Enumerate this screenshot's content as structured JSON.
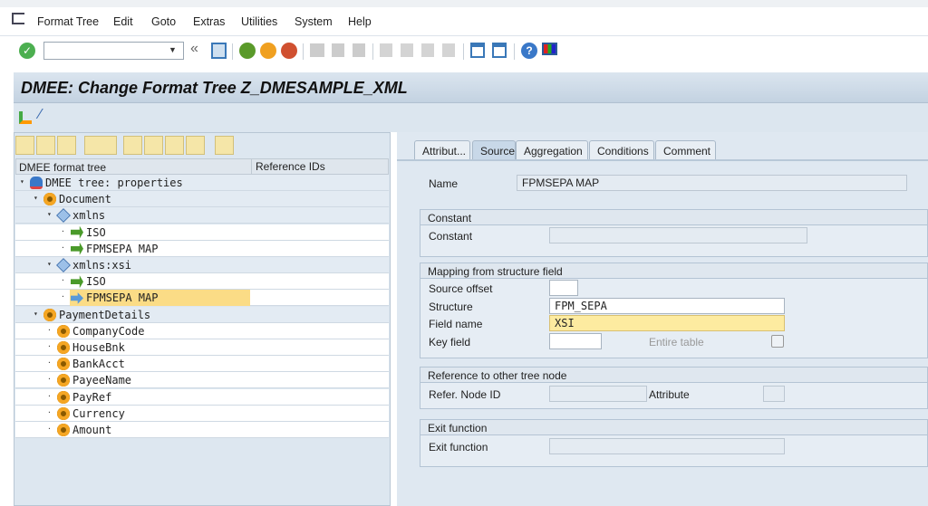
{
  "menubar": {
    "items": [
      "Format Tree",
      "Edit",
      "Goto",
      "Extras",
      "Utilities",
      "System",
      "Help"
    ]
  },
  "toolbar": {
    "command_field": "",
    "icons": [
      "enter-icon",
      "back-icon",
      "exit-icon",
      "cancel-icon",
      "save-icon",
      "print-icon",
      "find-icon",
      "find-next-icon",
      "first-page-icon",
      "prev-page-icon",
      "next-page-icon",
      "last-page-icon",
      "new-session-icon",
      "shortcut-icon",
      "help-icon",
      "customize-icon"
    ]
  },
  "title": "DMEE: Change Format Tree Z_DMESAMPLE_XML",
  "tree": {
    "columns": [
      "DMEE format tree",
      "Reference IDs"
    ],
    "rows": [
      {
        "label": "DMEE tree: properties",
        "level": 0,
        "icon": "tree-properties",
        "expanded": true
      },
      {
        "label": "Document",
        "level": 1,
        "icon": "node",
        "expanded": true
      },
      {
        "label": "xmlns",
        "level": 2,
        "icon": "attribute-tag",
        "expanded": true
      },
      {
        "label": "ISO",
        "level": 3,
        "icon": "mapping",
        "expanded": false
      },
      {
        "label": "FPMSEPA MAP",
        "level": 3,
        "icon": "mapping",
        "expanded": false
      },
      {
        "label": "xmlns:xsi",
        "level": 2,
        "icon": "attribute-tag",
        "expanded": true
      },
      {
        "label": "ISO",
        "level": 3,
        "icon": "mapping",
        "expanded": false
      },
      {
        "label": "FPMSEPA MAP",
        "level": 3,
        "icon": "arrow",
        "expanded": false,
        "selected": true
      },
      {
        "label": "PaymentDetails",
        "level": 1,
        "icon": "node",
        "expanded": true
      },
      {
        "label": "CompanyCode",
        "level": 2,
        "icon": "node",
        "expanded": false
      },
      {
        "label": "HouseBnk",
        "level": 2,
        "icon": "node",
        "expanded": false
      },
      {
        "label": "BankAcct",
        "level": 2,
        "icon": "node",
        "expanded": false
      },
      {
        "label": "PayeeName",
        "level": 2,
        "icon": "node",
        "expanded": false
      },
      {
        "label": "PayRef",
        "level": 2,
        "icon": "node",
        "expanded": false
      },
      {
        "label": "Currency",
        "level": 2,
        "icon": "node",
        "expanded": false
      },
      {
        "label": "Amount",
        "level": 2,
        "icon": "node",
        "expanded": false
      }
    ]
  },
  "tabs": [
    "Attribut...",
    "Source",
    "Aggregation",
    "Conditions",
    "Comment"
  ],
  "active_tab": "Source",
  "form": {
    "name_label": "Name",
    "name_value": "FPMSEPA MAP",
    "constant_group": "Constant",
    "constant_label": "Constant",
    "constant_value": "",
    "mapping_group": "Mapping from structure field",
    "source_offset_label": "Source offset",
    "source_offset_value": "",
    "structure_label": "Structure",
    "structure_value": "FPM_SEPA",
    "field_name_label": "Field name",
    "field_name_value": "XSI",
    "key_field_label": "Key field",
    "key_field_value": "",
    "entire_table_label": "Entire table",
    "entire_table_checked": false,
    "reference_group": "Reference to other tree node",
    "refer_node_label": "Refer. Node ID",
    "refer_node_value": "",
    "attribute_label": "Attribute",
    "attribute_value": "",
    "exit_group": "Exit function",
    "exit_label": "Exit function",
    "exit_value": ""
  }
}
